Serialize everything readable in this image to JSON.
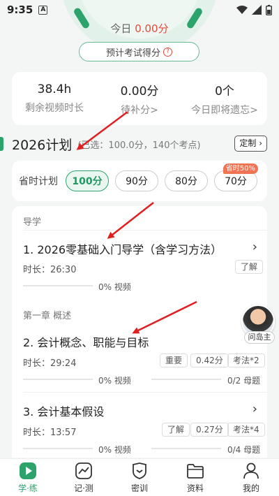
{
  "status_bar": {
    "time": "9:35",
    "notif": "A"
  },
  "dial": {
    "today_label": "今日",
    "today_value": "0.00分",
    "predict_label": "预计考试得分",
    "help": "?"
  },
  "stats": [
    {
      "num": "38.4h",
      "label": "剩余视频时长"
    },
    {
      "num": "0.00分",
      "label": "待补分>"
    },
    {
      "num": "0个",
      "label": "今日即将遗忘>"
    }
  ],
  "plan": {
    "title": "2026计划",
    "subtitle": "(已选：100.0分，140个考点)",
    "custom_label": "定制"
  },
  "time_plan": {
    "label": "省时计划",
    "options": [
      "100分",
      "90分",
      "80分",
      "70分"
    ],
    "selected": "100分",
    "save_tag": "省时50%"
  },
  "course": {
    "section_intro": "导学",
    "lesson1": {
      "title": "1. 2026零基础入门导学（含学习方法）",
      "duration": "时长：26:30",
      "tag": "了解",
      "progress": "0%",
      "progress_label": "视频"
    },
    "section_ch1": "第一章 概述",
    "lesson2": {
      "title": "2. 会计概念、职能与目标",
      "duration": "时长：29:24",
      "tags": [
        "重要",
        "0.42分",
        "考法*2"
      ],
      "progress": "0%",
      "progress_label": "视频",
      "q_progress": "0/2",
      "q_label": "母题"
    },
    "lesson3": {
      "title": "3. 会计基本假设",
      "duration": "时长：13:57",
      "tags": [
        "了解",
        "0.27分",
        "考法*4"
      ],
      "progress": "0%",
      "progress_label": "视频",
      "q_progress": "0/4",
      "q_label": "母题"
    }
  },
  "avatar_label": "问岛主",
  "nav": [
    {
      "label": "学·练",
      "icon": "play-icon"
    },
    {
      "label": "记·测",
      "icon": "chart-icon"
    },
    {
      "label": "密训",
      "icon": "shield-icon"
    },
    {
      "label": "资料",
      "icon": "folder-icon"
    },
    {
      "label": "我的",
      "icon": "user-icon"
    }
  ],
  "colors": {
    "accent": "#2ca36b",
    "score_red": "#e24a3b",
    "arrow_red": "#e02020"
  }
}
